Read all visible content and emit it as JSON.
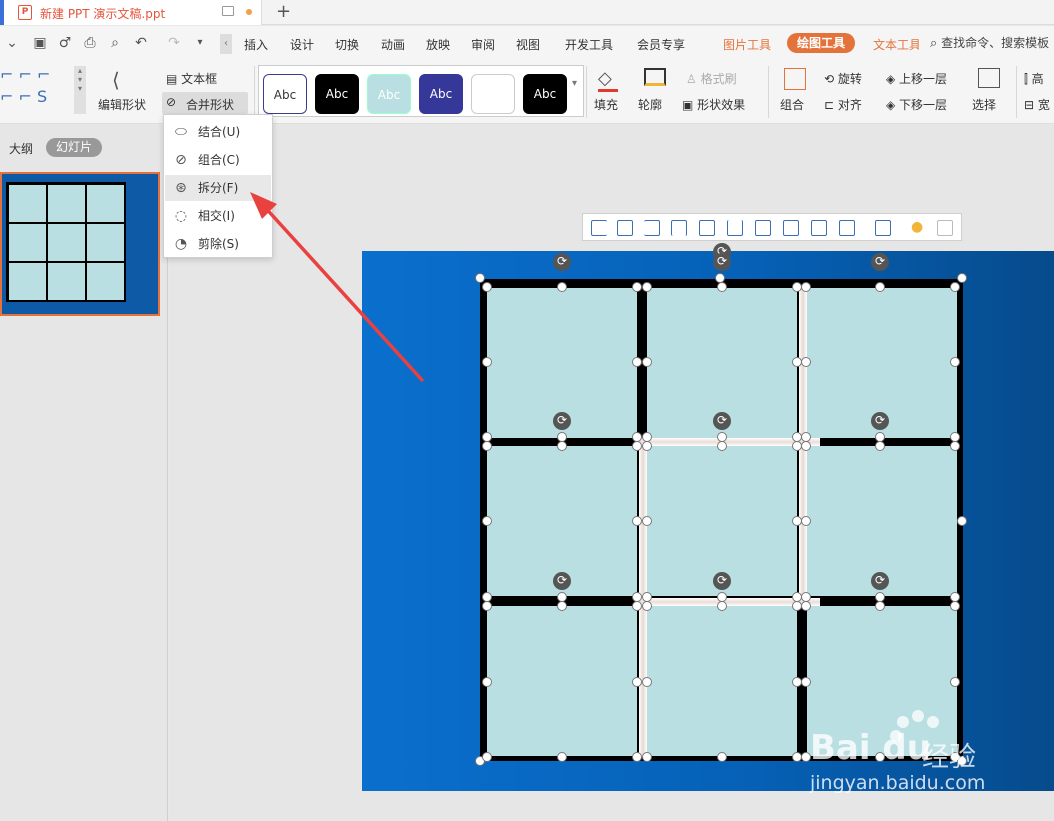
{
  "titlebar": {
    "doc_title": "新建 PPT 演示文稿.ppt",
    "app_icon": "P",
    "new_tab": "+"
  },
  "menu": {
    "items": [
      "插入",
      "设计",
      "切换",
      "动画",
      "放映",
      "审阅",
      "视图",
      "开发工具",
      "会员专享"
    ],
    "context_tabs": {
      "picture_tools": "图片工具",
      "drawing_tools": "绘图工具",
      "text_tools": "文本工具"
    },
    "search": "查找命令、搜索模板"
  },
  "ribbon": {
    "edit_shape": "编辑形状",
    "text_box": "文本框",
    "merge_shapes": "合并形状",
    "style_samples": [
      "Abc",
      "Abc",
      "Abc",
      "Abc",
      "",
      "Abc"
    ],
    "fill": "填充",
    "outline": "轮廓",
    "format_painter": "格式刷",
    "shape_effects": "形状效果",
    "rotate": "旋转",
    "bring_forward": "上移一层",
    "group": "组合",
    "align": "对齐",
    "send_backward": "下移一层",
    "select": "选择",
    "partial_right_1": "高",
    "partial_right_2": "宽"
  },
  "panel": {
    "tab_outline": "大纲",
    "tab_slides": "幻灯片"
  },
  "merge_menu": {
    "items": [
      {
        "label": "结合(U)",
        "icon": "union-icon"
      },
      {
        "label": "组合(C)",
        "icon": "combine-icon"
      },
      {
        "label": "拆分(F)",
        "icon": "fragment-icon"
      },
      {
        "label": "相交(I)",
        "icon": "intersect-icon"
      },
      {
        "label": "剪除(S)",
        "icon": "subtract-icon"
      }
    ]
  },
  "watermark": {
    "brand": "Bai  du",
    "product": "经验",
    "url": "jingyan.baidu.com"
  },
  "colors": {
    "accent": "#e4733b",
    "slide_blue": "#0a6fcd",
    "cell": "#b9dfe2",
    "arrow": "#e8413f"
  }
}
